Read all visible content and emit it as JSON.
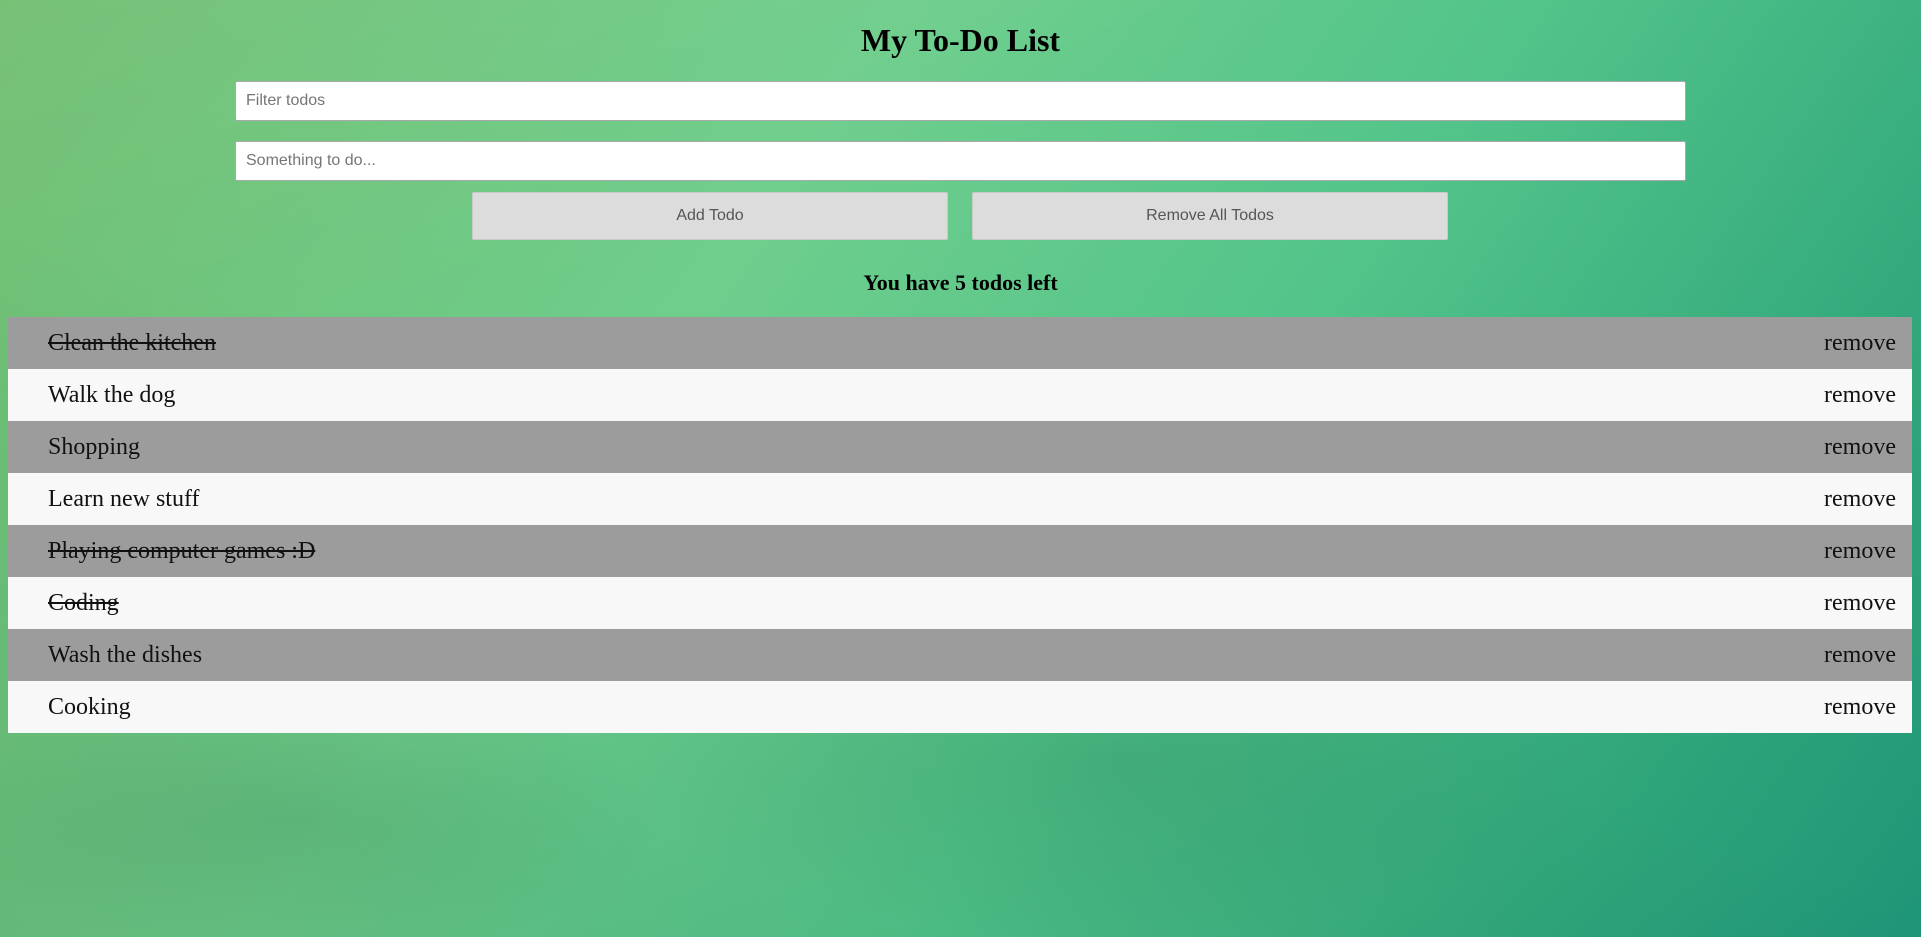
{
  "header": {
    "title": "My To-Do List"
  },
  "filter": {
    "placeholder": "Filter todos",
    "value": ""
  },
  "new_todo": {
    "placeholder": "Something to do...",
    "value": ""
  },
  "buttons": {
    "add_label": "Add Todo",
    "remove_all_label": "Remove All Todos"
  },
  "summary": {
    "text": "You have 5 todos left"
  },
  "todos": [
    {
      "text": "Clean the kitchen",
      "completed": true,
      "remove_label": "remove"
    },
    {
      "text": "Walk the dog",
      "completed": false,
      "remove_label": "remove"
    },
    {
      "text": "Shopping",
      "completed": false,
      "remove_label": "remove"
    },
    {
      "text": "Learn new stuff",
      "completed": false,
      "remove_label": "remove"
    },
    {
      "text": "Playing computer games :D",
      "completed": true,
      "remove_label": "remove"
    },
    {
      "text": "Coding",
      "completed": true,
      "remove_label": "remove"
    },
    {
      "text": "Wash the dishes",
      "completed": false,
      "remove_label": "remove"
    },
    {
      "text": "Cooking",
      "completed": false,
      "remove_label": "remove"
    }
  ],
  "colors": {
    "row_dark": "#9c9c9c",
    "row_light": "#f8f8f8",
    "button_bg": "#dcdcdc",
    "background_start": "#6cbc6c",
    "background_end": "#1f9578"
  }
}
